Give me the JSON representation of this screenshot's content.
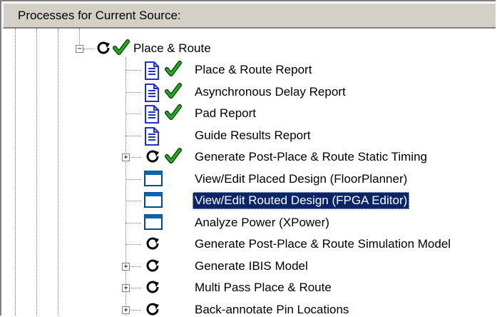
{
  "header": {
    "title": "Processes for Current Source:"
  },
  "tree": {
    "root": {
      "label": "Place & Route",
      "expander": "−",
      "status_icon": "refresh-icon",
      "check": true
    },
    "items": [
      {
        "label": "Place & Route Report",
        "icon": "report-icon",
        "check": true,
        "expander": ""
      },
      {
        "label": "Asynchronous Delay Report",
        "icon": "report-icon",
        "check": true,
        "expander": ""
      },
      {
        "label": "Pad Report",
        "icon": "report-icon",
        "check": true,
        "expander": ""
      },
      {
        "label": "Guide Results Report",
        "icon": "report-icon",
        "check": false,
        "expander": ""
      },
      {
        "label": "Generate Post-Place & Route Static Timing",
        "icon": "refresh-icon",
        "check": true,
        "expander": "+"
      },
      {
        "label": "View/Edit Placed Design (FloorPlanner)",
        "icon": "window-icon",
        "check": false,
        "expander": ""
      },
      {
        "label": "View/Edit Routed Design (FPGA Editor)",
        "icon": "window-icon",
        "check": false,
        "expander": "",
        "selected": true
      },
      {
        "label": "Analyze Power (XPower)",
        "icon": "window-icon",
        "check": false,
        "expander": ""
      },
      {
        "label": "Generate Post-Place & Route Simulation Model",
        "icon": "refresh-icon",
        "check": false,
        "expander": ""
      },
      {
        "label": "Generate IBIS Model",
        "icon": "refresh-icon",
        "check": false,
        "expander": "+"
      },
      {
        "label": "Multi Pass Place & Route",
        "icon": "refresh-icon",
        "check": false,
        "expander": "+"
      },
      {
        "label": "Back-annotate Pin Locations",
        "icon": "refresh-icon",
        "check": false,
        "expander": "+"
      }
    ]
  },
  "colors": {
    "selection": "#0a246a",
    "check": "#1fae1f",
    "header_bg": "#d4d0c8",
    "report_blue": "#1f2fd1"
  }
}
